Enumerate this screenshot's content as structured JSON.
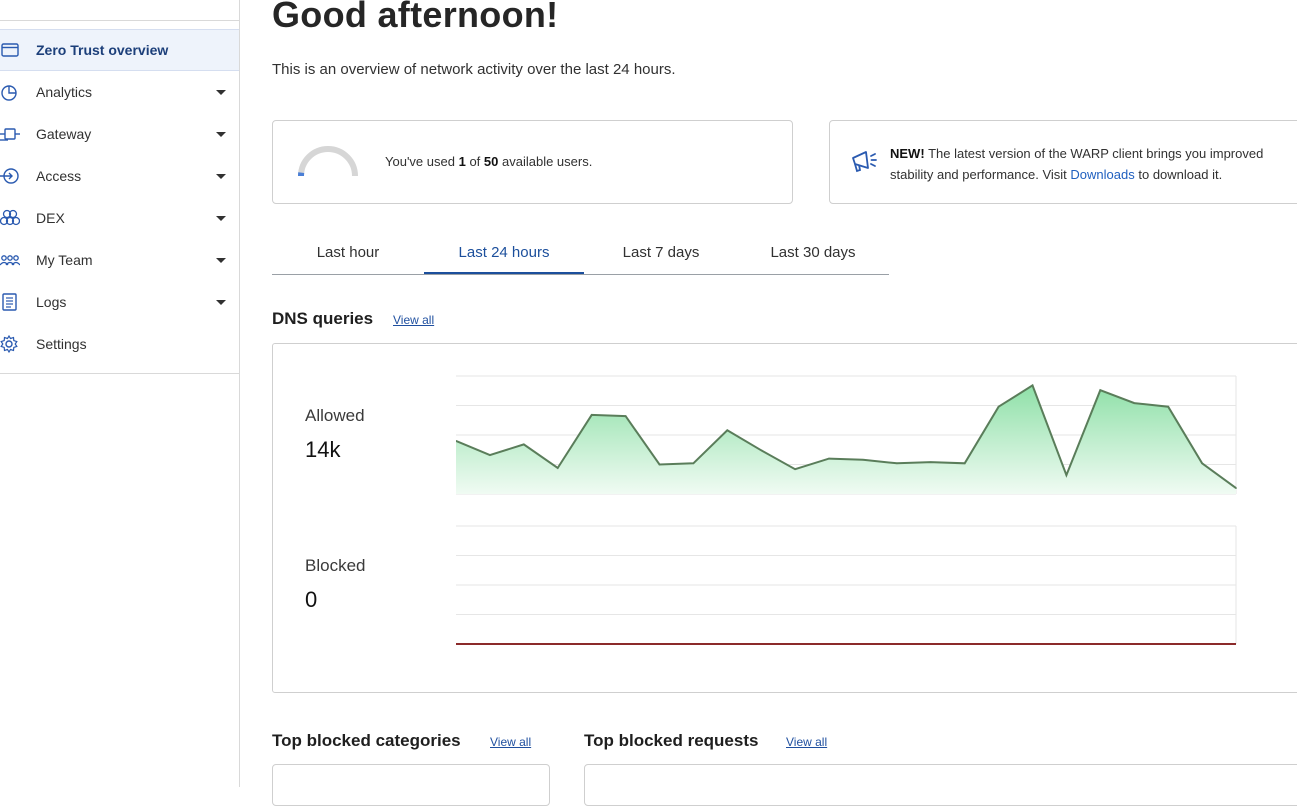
{
  "sidebar": {
    "items": [
      {
        "label": "Zero Trust overview",
        "icon": "browser-window-icon",
        "active": true,
        "has_caret": false
      },
      {
        "label": "Analytics",
        "icon": "pie-chart-icon",
        "active": false,
        "has_caret": true
      },
      {
        "label": "Gateway",
        "icon": "gateway-icon",
        "active": false,
        "has_caret": true
      },
      {
        "label": "Access",
        "icon": "access-icon",
        "active": false,
        "has_caret": true
      },
      {
        "label": "DEX",
        "icon": "dex-icon",
        "active": false,
        "has_caret": true
      },
      {
        "label": "My Team",
        "icon": "team-icon",
        "active": false,
        "has_caret": true
      },
      {
        "label": "Logs",
        "icon": "logs-icon",
        "active": false,
        "has_caret": true
      },
      {
        "label": "Settings",
        "icon": "gear-icon",
        "active": false,
        "has_caret": false
      }
    ]
  },
  "header": {
    "title": "Good afternoon!",
    "subtitle": "This is an overview of network activity over the last 24 hours."
  },
  "users_card": {
    "prefix": "You've used",
    "used": "1",
    "of": "of",
    "total": "50",
    "suffix": "available users.",
    "usage_fraction": 0.02
  },
  "news_card": {
    "badge": "NEW!",
    "text1": "The latest version of the WARP client brings you improved stability and performance. Visit",
    "link": "Downloads",
    "text2": "to download it."
  },
  "tabs": [
    {
      "label": "Last hour",
      "active": false
    },
    {
      "label": "Last 24 hours",
      "active": true
    },
    {
      "label": "Last 7 days",
      "active": false
    },
    {
      "label": "Last 30 days",
      "active": false
    }
  ],
  "dns": {
    "title": "DNS queries",
    "view_all": "View all",
    "allowed_label": "Allowed",
    "allowed_value": "14k",
    "blocked_label": "Blocked",
    "blocked_value": "0"
  },
  "chart_data": [
    {
      "type": "area",
      "series": [
        {
          "values": [
            0.45,
            0.33,
            0.42,
            0.22,
            0.67,
            0.66,
            0.25,
            0.26,
            0.54,
            0.37,
            0.21,
            0.3,
            0.29,
            0.26,
            0.27,
            0.26,
            0.74,
            0.92,
            0.16,
            0.88,
            0.77,
            0.74,
            0.26,
            0.05
          ]
        }
      ],
      "ylim": [
        0,
        1
      ],
      "grid": true,
      "colors": {
        "line": "#5a7d5a",
        "fill_top": "#8fe0a8",
        "fill_bottom": "#f0fbf3"
      }
    },
    {
      "type": "line",
      "series": [
        {
          "values": [
            0,
            0
          ]
        }
      ],
      "ylim": [
        0,
        1
      ],
      "grid": true,
      "colors": {
        "line": "#8b2a2a"
      }
    }
  ],
  "bottom": {
    "categories_title": "Top blocked categories",
    "categories_view_all": "View all",
    "requests_title": "Top blocked requests",
    "requests_view_all": "View all"
  },
  "colors": {
    "accent": "#1c4f9c",
    "active_bg": "#eef3fb"
  }
}
